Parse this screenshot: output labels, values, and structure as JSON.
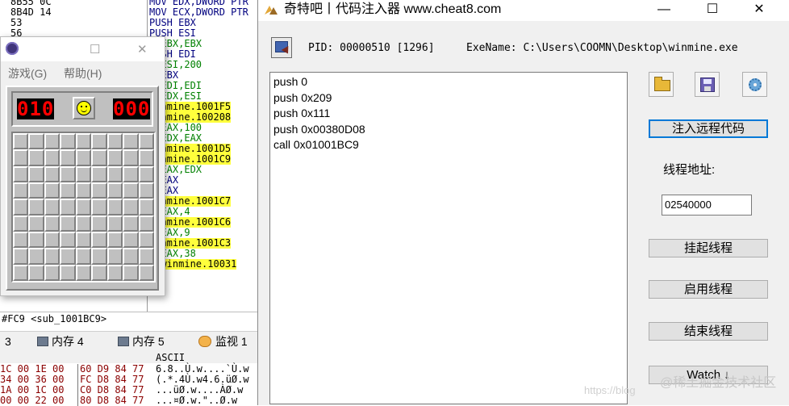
{
  "background": {
    "left_asm": [
      "8B55 0C",
      "8B4D 14",
      "53",
      "56"
    ],
    "mid_asm": [
      {
        "text": "MOV EDX,DWORD PTR",
        "kind": "op"
      },
      {
        "text": "MOV ECX,DWORD PTR",
        "kind": "op"
      },
      {
        "text": "PUSH EBX",
        "kind": "op"
      },
      {
        "text": "PUSH ESI",
        "kind": "op"
      },
      {
        "text": "  EBX,EBX",
        "kind": "reg"
      },
      {
        "text": "  SH EDI",
        "kind": "op"
      },
      {
        "text": "  ESI,200",
        "kind": "reg"
      },
      {
        "text": "  EBX",
        "kind": "op"
      },
      {
        "text": "  EDI,EDI",
        "kind": "reg"
      },
      {
        "text": "  EDX,ESI",
        "kind": "reg"
      },
      {
        "text": "winmine.1001F5",
        "kind": "hl"
      },
      {
        "text": "winmine.100208",
        "kind": "hl"
      },
      {
        "text": "  EAX,100",
        "kind": "reg"
      },
      {
        "text": "  EDX,EAX",
        "kind": "reg"
      },
      {
        "text": "winmine.1001D5",
        "kind": "hl"
      },
      {
        "text": "winmine.1001C9",
        "kind": "hl"
      },
      {
        "text": "  EAX,EDX",
        "kind": "reg"
      },
      {
        "text": "  EAX",
        "kind": "op"
      },
      {
        "text": "  EAX",
        "kind": "op"
      },
      {
        "text": "winmine.1001C7",
        "kind": "hl"
      },
      {
        "text": "  EAX,4",
        "kind": "reg"
      },
      {
        "text": "winmine.1001C6",
        "kind": "hl"
      },
      {
        "text": "  EAX,9",
        "kind": "reg"
      },
      {
        "text": "winmine.1001C3",
        "kind": "hl"
      },
      {
        "text": "  EAX,38",
        "kind": "reg"
      },
      {
        "text": "  winmine.10031",
        "kind": "hl"
      }
    ],
    "address_bar": "#FC9 <sub_1001BC9>",
    "tabs": [
      {
        "label": "3"
      },
      {
        "label": "内存 4"
      },
      {
        "label": "内存 5"
      },
      {
        "label": "监视 1"
      }
    ],
    "hex_header": "ASCII",
    "hex_rows": [
      {
        "a": "1C 00 1E 00",
        "b": "60 D9 84 77",
        "c": "6.8..Ù.w....`Ù.w"
      },
      {
        "a": "34 00 36 00",
        "b": "FC D8 84 77",
        "c": "(.*.4Ù.w4.6.üØ.w"
      },
      {
        "a": "1A 00 1C 00",
        "b": "C0 D8 84 77",
        "c": "...üØ.w....ÀØ.w"
      },
      {
        "a": "00 00 22 00",
        "b": "80 D8 84 77",
        "c": "...¤Ø.w.\"..Ø.w"
      }
    ],
    "right_edge_chars": [
      "C",
      "C",
      "C",
      "C"
    ]
  },
  "minesweeper": {
    "menu": [
      "游戏(G)",
      "帮助(H)"
    ],
    "mine_counter": "010",
    "timer": "000",
    "grid_size": 9
  },
  "injector": {
    "title": "奇特吧丨代码注入器 www.cheat8.com",
    "window_controls": {
      "minimize": "—",
      "maximize": "☐",
      "close": "✕"
    },
    "pid_label": "PID: 00000510 [1296]",
    "exe_label": "ExeName: C:\\Users\\COOMN\\Desktop\\winmine.exe",
    "code_lines": [
      "push 0",
      "push 0x209",
      "push 0x111",
      "push 0x00380D08",
      "call 0x01001BC9"
    ],
    "buttons": {
      "inject": "注入远程代码",
      "suspend": "挂起线程",
      "resume": "启用线程",
      "terminate": "结束线程",
      "watch": "Watch ↓"
    },
    "thread_label": "线程地址:",
    "thread_value": "02540000",
    "watermark": "@稀土掘金技术社区",
    "watermark_url": "https://blog"
  }
}
